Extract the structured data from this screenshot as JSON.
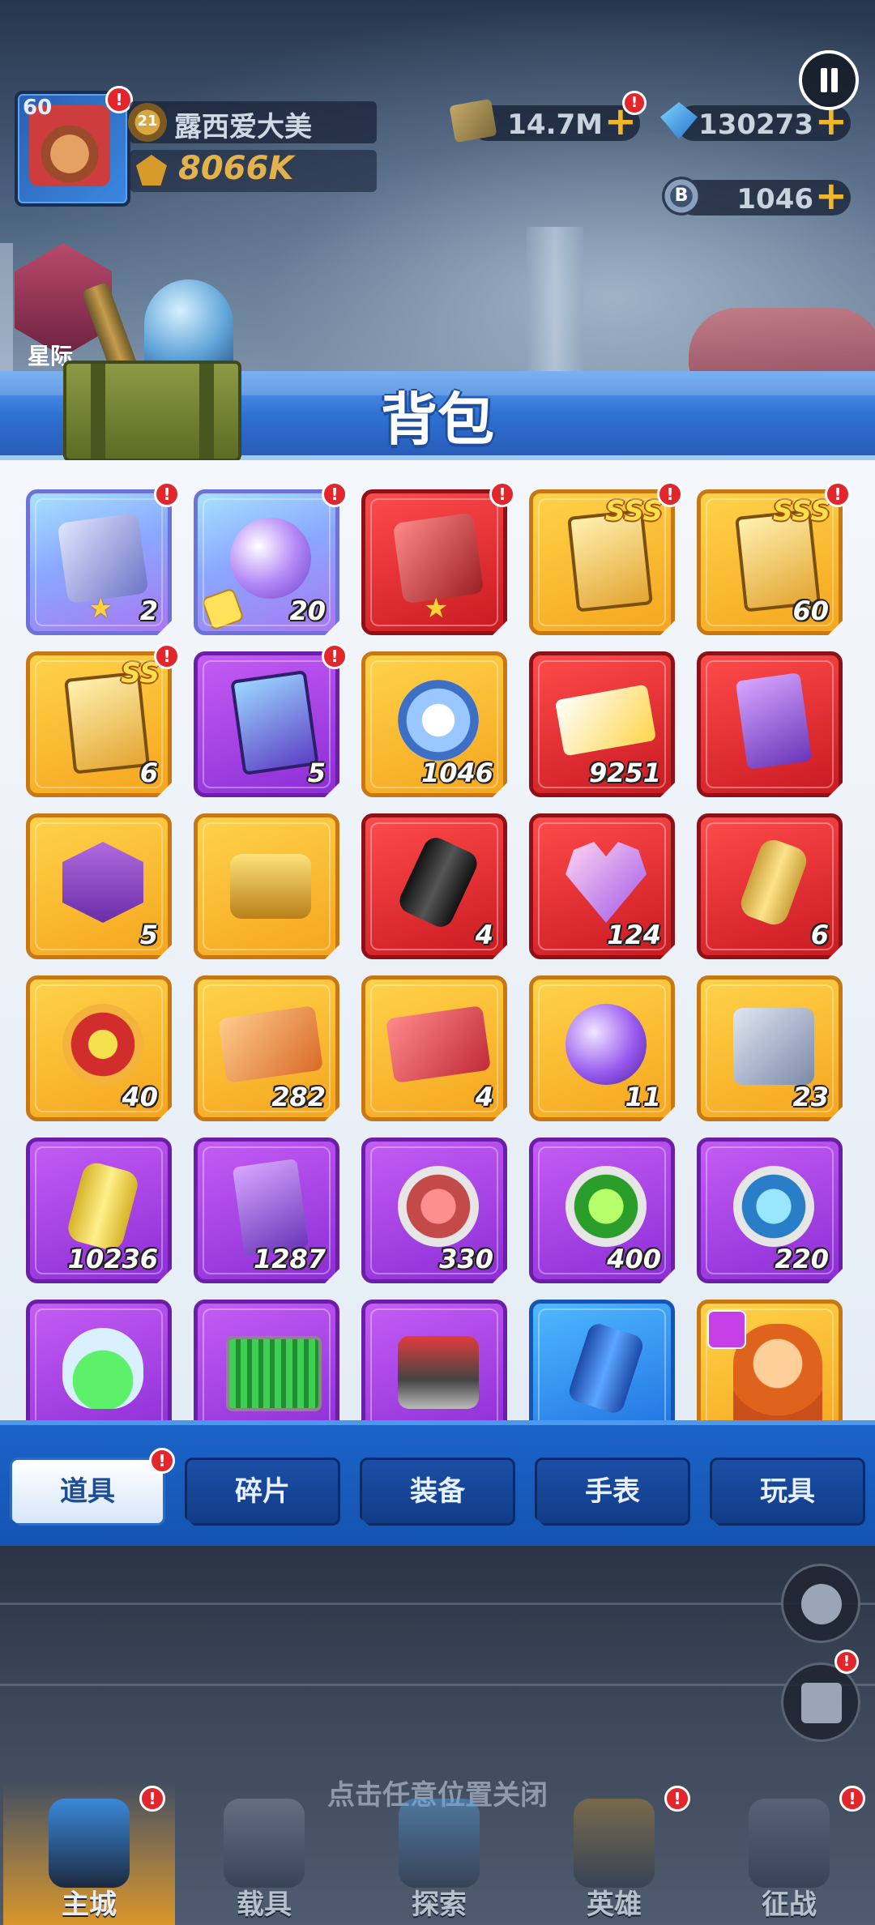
{
  "player": {
    "level": "60",
    "name": "露西爱大美",
    "rank": "21",
    "power": "8066K"
  },
  "currencies": {
    "cash": "14.7M",
    "gems": "130273",
    "coins": "1046"
  },
  "left_menu": {
    "star_label": "星际"
  },
  "panel": {
    "title": "背包",
    "rows": [
      [
        {
          "rarity": "blue",
          "art": "box",
          "qty": "2",
          "star": true,
          "alert": true
        },
        {
          "rarity": "blue",
          "art": "orb",
          "qty": "20",
          "puzzle": true,
          "alert": true
        },
        {
          "rarity": "red",
          "art": "box-red",
          "qty": "",
          "star": true,
          "alert": true
        },
        {
          "rarity": "gold",
          "art": "card",
          "qty": "",
          "grade": "SSS",
          "alert": true
        },
        {
          "rarity": "gold",
          "art": "card",
          "qty": "60",
          "grade": "SSS",
          "alert": true
        }
      ],
      [
        {
          "rarity": "gold",
          "art": "card",
          "qty": "6",
          "grade": "SS",
          "alert": true
        },
        {
          "rarity": "purple",
          "art": "card-v",
          "qty": "5",
          "alert": true
        },
        {
          "rarity": "gold",
          "art": "coin",
          "qty": "1046"
        },
        {
          "rarity": "red",
          "art": "ticket",
          "qty": "9251"
        },
        {
          "rarity": "red",
          "art": "scroll",
          "qty": ""
        }
      ],
      [
        {
          "rarity": "gold",
          "art": "hex",
          "qty": "5"
        },
        {
          "rarity": "gold",
          "art": "chest",
          "qty": ""
        },
        {
          "rarity": "red",
          "art": "cyl",
          "qty": "4"
        },
        {
          "rarity": "red",
          "art": "heart",
          "qty": "124"
        },
        {
          "rarity": "red",
          "art": "bottle",
          "qty": "6"
        }
      ],
      [
        {
          "rarity": "gold",
          "art": "medal",
          "qty": "40"
        },
        {
          "rarity": "gold",
          "art": "ticket-o",
          "qty": "282"
        },
        {
          "rarity": "gold",
          "art": "ticket-r",
          "qty": "4"
        },
        {
          "rarity": "gold",
          "art": "planet",
          "qty": "11"
        },
        {
          "rarity": "gold",
          "art": "machine",
          "qty": "23"
        }
      ],
      [
        {
          "rarity": "purple",
          "art": "jar",
          "qty": "10236"
        },
        {
          "rarity": "purple",
          "art": "scroll",
          "qty": "1287"
        },
        {
          "rarity": "purple",
          "art": "pin-red",
          "qty": "330"
        },
        {
          "rarity": "purple",
          "art": "pin-green",
          "qty": "400"
        },
        {
          "rarity": "purple",
          "art": "pin-blue",
          "qty": "220"
        }
      ],
      [
        {
          "rarity": "purple",
          "art": "flask",
          "qty": ""
        },
        {
          "rarity": "purple",
          "art": "chip",
          "qty": ""
        },
        {
          "rarity": "purple",
          "art": "gadget",
          "qty": ""
        },
        {
          "rarity": "cyan",
          "art": "can",
          "qty": ""
        },
        {
          "rarity": "gold",
          "art": "hero",
          "qty": "",
          "hero_badge": true
        }
      ]
    ],
    "tabs": [
      {
        "label": "道具",
        "active": true,
        "alert": true
      },
      {
        "label": "碎片",
        "active": false
      },
      {
        "label": "装备",
        "active": false
      },
      {
        "label": "手表",
        "active": false
      },
      {
        "label": "玩具",
        "active": false
      }
    ]
  },
  "close_hint": "点击任意位置关闭",
  "bottom_nav": [
    {
      "label": "主城",
      "active": true,
      "alert": true
    },
    {
      "label": "载具",
      "active": false
    },
    {
      "label": "探索",
      "active": false
    },
    {
      "label": "英雄",
      "active": false,
      "alert": true
    },
    {
      "label": "征战",
      "active": false,
      "alert": true
    }
  ],
  "colors": {
    "panel_header": "#2d6fd0",
    "tab_bar": "#1b63c9",
    "alert": "#e2262c",
    "gold_tile": "#f5a51e",
    "red_tile": "#c91a22",
    "purple_tile": "#8b2ed5",
    "blue_tile": "#8aa8ff"
  }
}
